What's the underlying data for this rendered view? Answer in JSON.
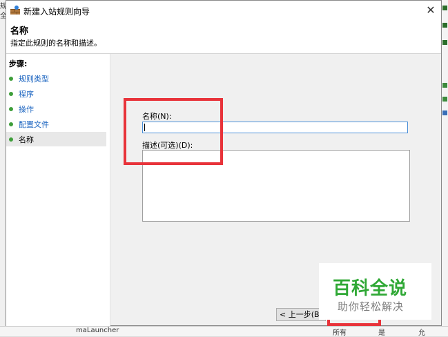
{
  "window": {
    "title": "新建入站规则向导",
    "close_glyph": "✕"
  },
  "header": {
    "title": "名称",
    "description": "指定此规则的名称和描述。"
  },
  "steps": {
    "title": "步骤:",
    "items": [
      {
        "label": "规则类型"
      },
      {
        "label": "程序"
      },
      {
        "label": "操作"
      },
      {
        "label": "配置文件"
      },
      {
        "label": "名称"
      }
    ],
    "active_index": 4
  },
  "form": {
    "name_label": "名称(N):",
    "name_value": "",
    "description_label": "描述(可选)(D):",
    "description_value": ""
  },
  "buttons": {
    "back": "< 上一步(B)"
  },
  "background": {
    "left_chars": [
      "规",
      "全"
    ],
    "bottom_texts": [
      "maLauncher",
      "所有",
      "是",
      "允"
    ]
  },
  "watermark": {
    "main": "百科全说",
    "sub": "助你轻松解决"
  },
  "colors": {
    "highlight": "#e8333a",
    "link": "#1b64c0",
    "step_dot": "#3e9e3a",
    "watermark_green": "#2fa835"
  },
  "icons": {
    "app": "firewall-icon",
    "close": "close-icon",
    "step": "step-dot-icon"
  }
}
